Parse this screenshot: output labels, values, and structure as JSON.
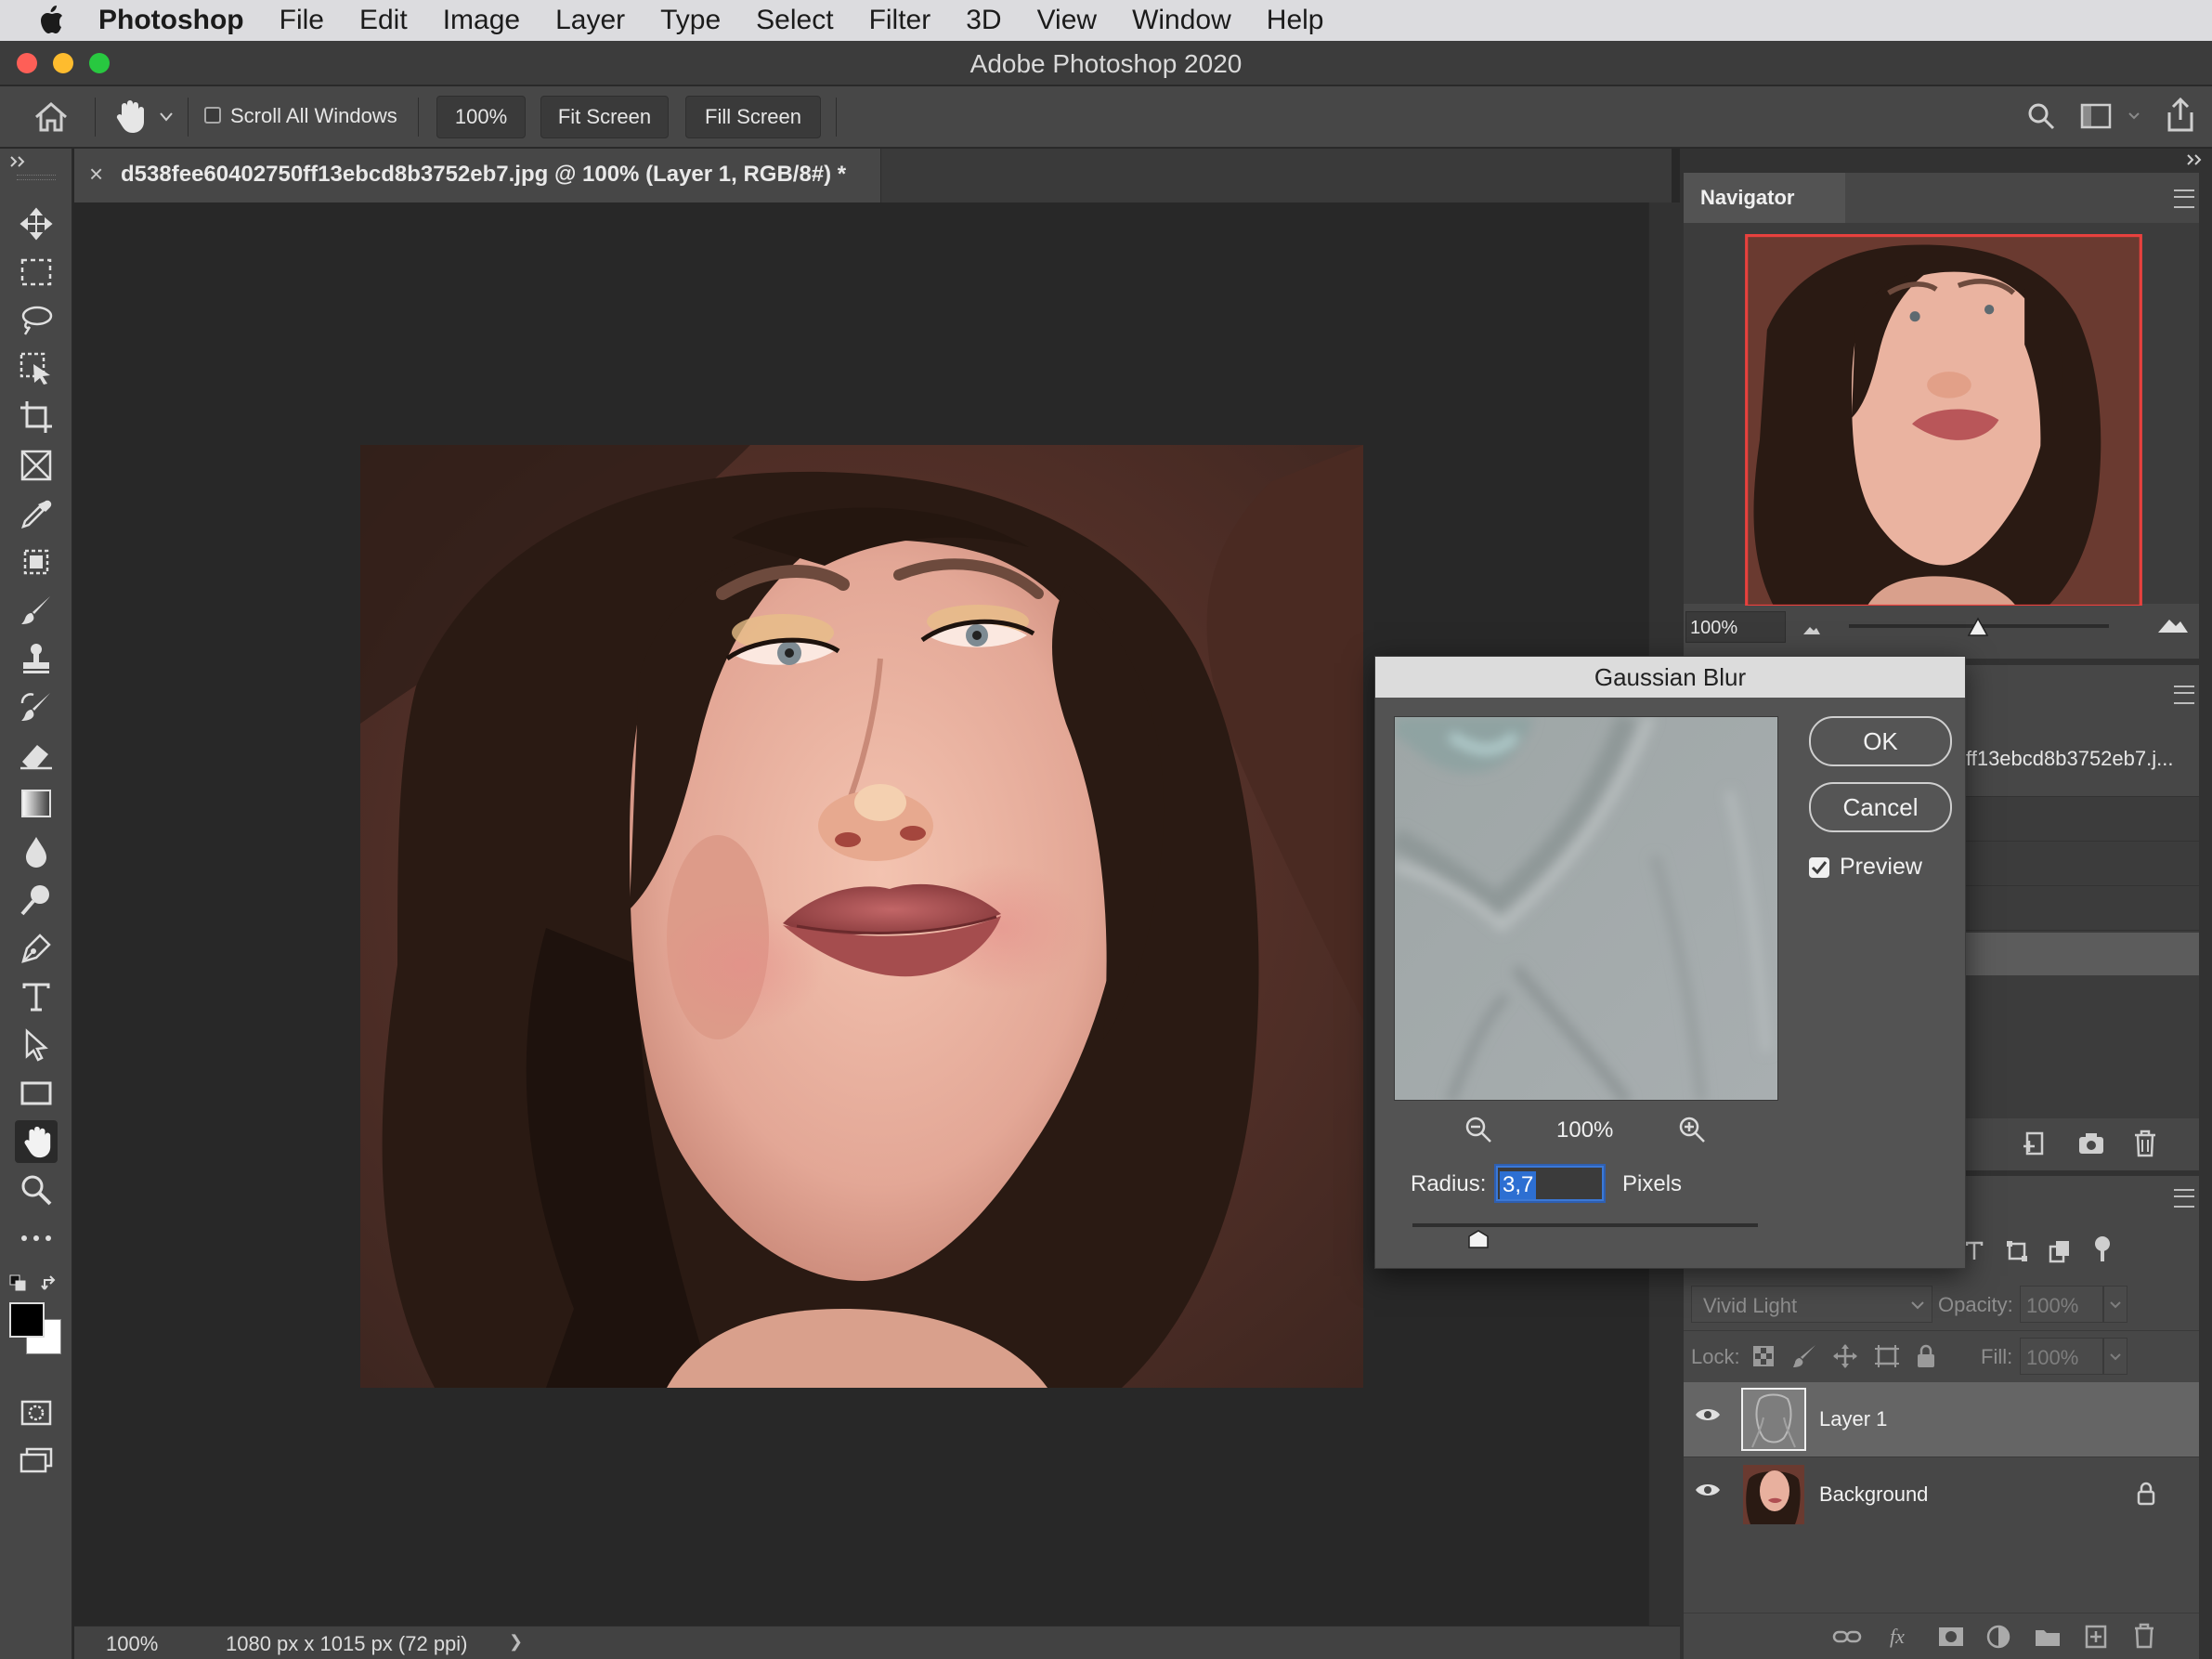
{
  "menubar": {
    "app_name": "Photoshop",
    "items": [
      "File",
      "Edit",
      "Image",
      "Layer",
      "Type",
      "Select",
      "Filter",
      "3D",
      "View",
      "Window",
      "Help"
    ]
  },
  "window": {
    "title": "Adobe Photoshop 2020"
  },
  "options_bar": {
    "scroll_all_windows_label": "Scroll All Windows",
    "scroll_all_windows_checked": false,
    "zoom_button": "100%",
    "fit_screen": "Fit Screen",
    "fill_screen": "Fill Screen"
  },
  "document": {
    "tab_label": "d538fee60402750ff13ebcd8b3752eb7.jpg @ 100% (Layer 1, RGB/8#) *",
    "close_glyph": "×"
  },
  "status_bar": {
    "zoom": "100%",
    "doc_info": "1080 px x 1015 px (72 ppi)",
    "arrow": "❯"
  },
  "navigator": {
    "title": "Navigator",
    "zoom": "100%"
  },
  "history": {
    "snapshot_label": "ff13ebcd8b3752eb7.j..."
  },
  "gaussian_blur": {
    "title": "Gaussian Blur",
    "ok": "OK",
    "cancel": "Cancel",
    "preview_label": "Preview",
    "preview_checked": true,
    "preview_zoom": "100%",
    "radius_label": "Radius:",
    "radius_value": "3,7",
    "units": "Pixels",
    "slider_position": 0.19
  },
  "layers_panel": {
    "blend_mode": "Vivid Light",
    "opacity_label": "Opacity:",
    "opacity_value": "100%",
    "lock_label": "Lock:",
    "fill_label": "Fill:",
    "fill_value": "100%",
    "layers": [
      {
        "name": "Layer 1",
        "selected": true,
        "visible": true,
        "locked": false
      },
      {
        "name": "Background",
        "selected": false,
        "visible": true,
        "locked": true
      }
    ]
  },
  "colors": {
    "foreground": "#000000",
    "background": "#ffffff",
    "selection_accent": "#2d6fd2"
  }
}
